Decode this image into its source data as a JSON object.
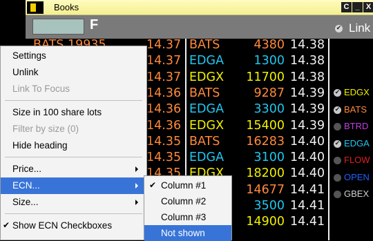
{
  "window": {
    "title": "Books",
    "controls": [
      "C",
      "_",
      "X"
    ]
  },
  "toolbar": {
    "symbol_value": "",
    "symbol_label": "F",
    "link_label": "Link",
    "link_checked": true
  },
  "rows": [
    {
      "ask_price": "14.37",
      "ecn": "BATS",
      "ecn_color": "#ff8a3c",
      "size": "4380",
      "price": "14.38",
      "left_partial": "BATS    19935"
    },
    {
      "ask_price": "14.37",
      "ecn": "EDGA",
      "ecn_color": "#1ec8f0",
      "size": "1300",
      "price": "14.38"
    },
    {
      "ask_price": "14.37",
      "ecn": "EDGX",
      "ecn_color": "#f0f000",
      "size": "11700",
      "price": "14.38"
    },
    {
      "ask_price": "14.36",
      "ecn": "BATS",
      "ecn_color": "#ff8a3c",
      "size": "9287",
      "price": "14.39"
    },
    {
      "ask_price": "14.36",
      "ecn": "EDGA",
      "ecn_color": "#1ec8f0",
      "size": "3300",
      "price": "14.39"
    },
    {
      "ask_price": "14.36",
      "ecn": "EDGX",
      "ecn_color": "#f0f000",
      "size": "15400",
      "price": "14.39"
    },
    {
      "ask_price": "14.35",
      "ecn": "BATS",
      "ecn_color": "#ff8a3c",
      "size": "16283",
      "price": "14.40"
    },
    {
      "ask_price": "14.35",
      "ecn": "EDGA",
      "ecn_color": "#1ec8f0",
      "size": "3100",
      "price": "14.40"
    },
    {
      "ask_price": "14.35",
      "ecn": "EDGX",
      "ecn_color": "#f0f000",
      "size": "18200",
      "price": "14.40"
    },
    {
      "ask_price": "",
      "ecn": "",
      "ecn_color": "#ff8a3c",
      "size": "14677",
      "price": "14.41"
    },
    {
      "ask_price": "",
      "ecn": "",
      "ecn_color": "#1ec8f0",
      "size": "3500",
      "price": "14.41"
    },
    {
      "ask_price": "",
      "ecn": "",
      "ecn_color": "#f0f000",
      "size": "14900",
      "price": "14.41"
    }
  ],
  "ecn_list": [
    {
      "name": "EDGX",
      "color": "#f0f000",
      "checked": true
    },
    {
      "name": "BATS",
      "color": "#ff8a3c",
      "checked": true
    },
    {
      "name": "BTRD",
      "color": "#c040e0",
      "checked": false
    },
    {
      "name": "EDGA",
      "color": "#1ec8f0",
      "checked": true
    },
    {
      "name": "FLOW",
      "color": "#e02020",
      "checked": false
    },
    {
      "name": "OPEN",
      "color": "#2060ff",
      "checked": false
    },
    {
      "name": "GBEX",
      "color": "#d0d0d0",
      "checked": false
    }
  ],
  "menu": {
    "items": [
      {
        "label": "Settings",
        "disabled": false
      },
      {
        "label": "Unlink",
        "disabled": false
      },
      {
        "label": "Link To Focus",
        "disabled": true
      },
      {
        "label": "Size in 100 share lots",
        "disabled": false
      },
      {
        "label": "Filter by size (0)",
        "disabled": true
      },
      {
        "label": "Hide heading",
        "disabled": false
      },
      {
        "label": "Price...",
        "disabled": false,
        "submenu": true
      },
      {
        "label": "ECN...",
        "disabled": false,
        "submenu": true,
        "selected": true
      },
      {
        "label": "Size...",
        "disabled": false,
        "submenu": true
      },
      {
        "label": "Show ECN Checkboxes",
        "disabled": false,
        "checked": true
      }
    ]
  },
  "submenu": {
    "items": [
      {
        "label": "Column #1",
        "checked": true
      },
      {
        "label": "Column #2",
        "checked": false
      },
      {
        "label": "Column #3",
        "checked": false
      },
      {
        "label": "Not shown",
        "checked": false,
        "selected": true
      }
    ]
  },
  "colors": {
    "ask_price": "#ff8a3c",
    "price": "#f0f0f0",
    "menu_highlight": "#3874d8",
    "title_bar": "#f4ef8f",
    "toolbar": "#7a7a7a"
  }
}
